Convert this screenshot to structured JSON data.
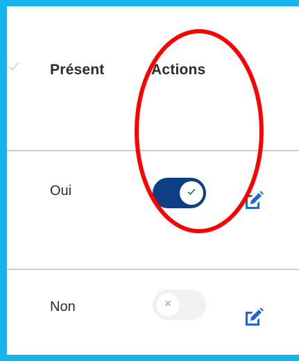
{
  "table": {
    "headers": {
      "present": "Présent",
      "actions": "Actions"
    },
    "rows": [
      {
        "present": "Oui",
        "toggle_on": true,
        "edit_icon": "edit-icon"
      },
      {
        "present": "Non",
        "toggle_on": false,
        "edit_icon": "edit-icon"
      }
    ]
  },
  "colors": {
    "background": "#14b4ec",
    "toggle_on": "#0e3f86",
    "toggle_off": "#f1f1f2",
    "edit_icon": "#1f66d1",
    "annotation": "#ff0000"
  }
}
